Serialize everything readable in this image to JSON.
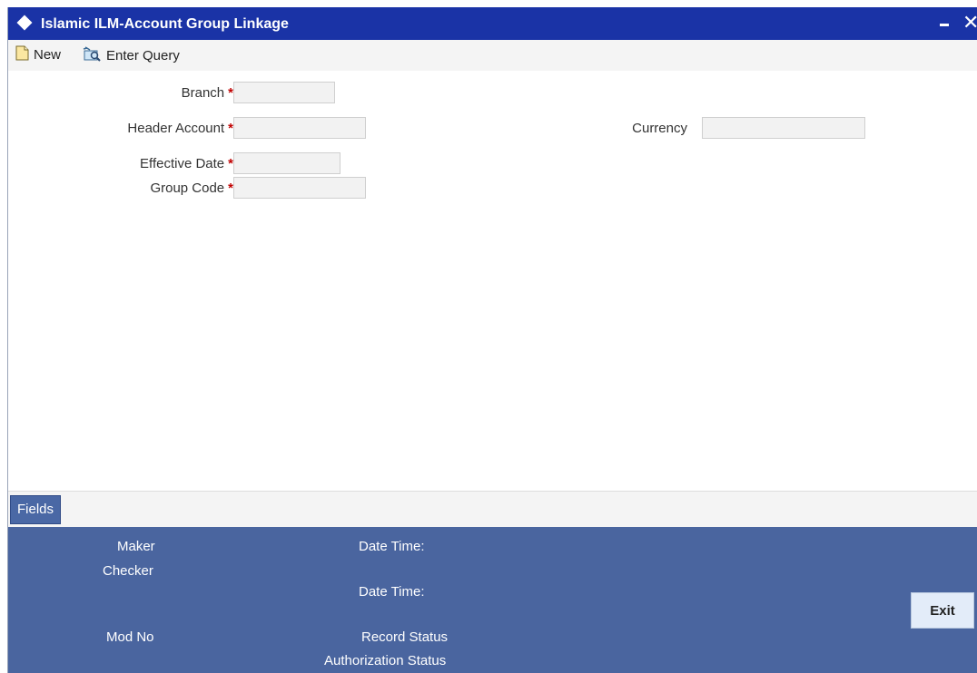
{
  "window": {
    "title": "Islamic ILM-Account Group Linkage",
    "title_bar_color": "#1a33a6"
  },
  "toolbar": {
    "new_label": "New",
    "enter_query_label": "Enter Query"
  },
  "form": {
    "required_marker": "*",
    "branch_label": "Branch",
    "branch_value": "",
    "header_account_label": "Header Account",
    "header_account_value": "",
    "currency_label": "Currency",
    "currency_value": "",
    "effective_date_label": "Effective Date",
    "effective_date_value": "",
    "group_code_label": "Group Code",
    "group_code_value": ""
  },
  "fields_button": "Fields",
  "footer": {
    "background_color": "#4a659f",
    "maker_label": "Maker",
    "checker_label": "Checker",
    "date_time_label_1": "Date Time:",
    "date_time_label_2": "Date Time:",
    "mod_no_label": "Mod No",
    "record_status_label": "Record Status",
    "authorization_status_label": "Authorization Status",
    "exit_label": "Exit"
  }
}
